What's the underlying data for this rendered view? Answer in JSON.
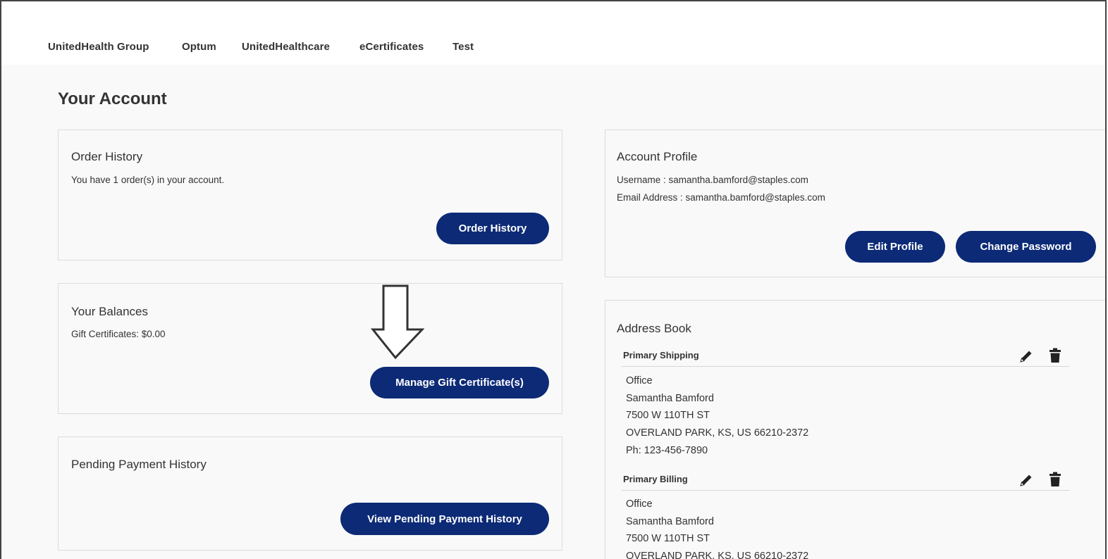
{
  "topnav": {
    "items": [
      "UnitedHealth Group",
      "Optum",
      "UnitedHealthcare",
      "eCertificates",
      "Test"
    ]
  },
  "page": {
    "title": "Your Account"
  },
  "order_history": {
    "title": "Order History",
    "text": "You have 1 order(s) in your account.",
    "button": "Order History"
  },
  "balances": {
    "title": "Your Balances",
    "text": "Gift Certificates: $0.00",
    "button": "Manage Gift Certificate(s)"
  },
  "pending": {
    "title": "Pending Payment History",
    "button": "View Pending Payment History"
  },
  "profile": {
    "title": "Account Profile",
    "username": "Username : samantha.bamford@staples.com",
    "email": "Email Address : samantha.bamford@staples.com",
    "edit_button": "Edit Profile",
    "password_button": "Change Password"
  },
  "address_book": {
    "title": "Address Book",
    "entries": [
      {
        "label": "Primary Shipping",
        "lines": [
          "Office",
          "Samantha Bamford",
          "7500 W 110TH ST",
          "OVERLAND PARK, KS, US 66210-2372",
          "Ph: 123-456-7890"
        ]
      },
      {
        "label": "Primary Billing",
        "lines": [
          "Office",
          "Samantha Bamford",
          "7500 W 110TH ST",
          "OVERLAND PARK, KS, US 66210-2372"
        ]
      }
    ]
  },
  "colors": {
    "button_bg": "#0c2a76",
    "page_bg": "#f9f9f9"
  },
  "icons": {
    "edit": "pencil-icon",
    "delete": "trash-icon",
    "callout": "down-arrow-icon"
  }
}
